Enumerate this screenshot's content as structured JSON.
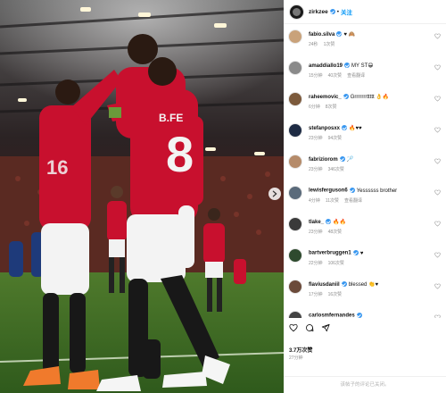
{
  "post": {
    "author": "zirkzee",
    "follow_label": "关注",
    "likes": "3.7万次赞",
    "time": "27分钟",
    "footer": "该帖子的评论已关闭。",
    "jersey_name": "B.FE",
    "jersey_number": "8",
    "shirt_number_left": "16"
  },
  "comments": [
    {
      "user": "fabio.silva",
      "verified": true,
      "text": "♥ 🙈",
      "time": "24秒",
      "likes": "1次赞",
      "reply": "",
      "avatar_color": "#c9a27a"
    },
    {
      "user": "amaddiallo19",
      "verified": true,
      "text": "MY ST😁",
      "time": "15分钟",
      "likes": "40次赞",
      "reply": "查看翻译",
      "avatar_color": "#8a8a8a"
    },
    {
      "user": "raheemovic_",
      "verified": true,
      "text": "Grrrrrrrttttt 👌🔥",
      "time": "6分钟",
      "likes": "8次赞",
      "reply": "",
      "avatar_color": "#7c5a3c"
    },
    {
      "user": "stefanposxx",
      "verified": true,
      "text": "🔥♥♥",
      "time": "23分钟",
      "likes": "94次赞",
      "reply": "",
      "avatar_color": "#1e2b44"
    },
    {
      "user": "fabriziorom",
      "verified": true,
      "text": "🏸",
      "time": "23分钟",
      "likes": "346次赞",
      "reply": "",
      "avatar_color": "#b58b6a"
    },
    {
      "user": "lewisferguson6",
      "verified": true,
      "text": "Yessssss brother",
      "time": "4分钟",
      "likes": "11次赞",
      "reply": "查看翻译",
      "avatar_color": "#5a6a7a"
    },
    {
      "user": "tlake_",
      "verified": true,
      "text": "🔥🔥",
      "time": "23分钟",
      "likes": "48次赞",
      "reply": "",
      "avatar_color": "#3a3a3a"
    },
    {
      "user": "bartverbruggen1",
      "verified": true,
      "text": "♥",
      "time": "22分钟",
      "likes": "106次赞",
      "reply": "",
      "avatar_color": "#2e4a2e"
    },
    {
      "user": "flaviusdaniil",
      "verified": true,
      "text": "blessed 👏♥",
      "time": "17分钟",
      "likes": "16次赞",
      "reply": "",
      "avatar_color": "#6b4a3a"
    },
    {
      "user": "carlosmfernandes",
      "verified": true,
      "text": "",
      "time": "",
      "likes": "",
      "reply": "",
      "avatar_color": "#444444"
    }
  ],
  "colors": {
    "kit_red": "#c8102e",
    "verified_blue": "#3897f0",
    "link_blue": "#0095f6",
    "meta_grey": "#8e8e8e"
  },
  "icons": [
    "heart-icon",
    "comment-icon",
    "share-icon",
    "chevron-right-icon",
    "verified-badge-icon"
  ]
}
